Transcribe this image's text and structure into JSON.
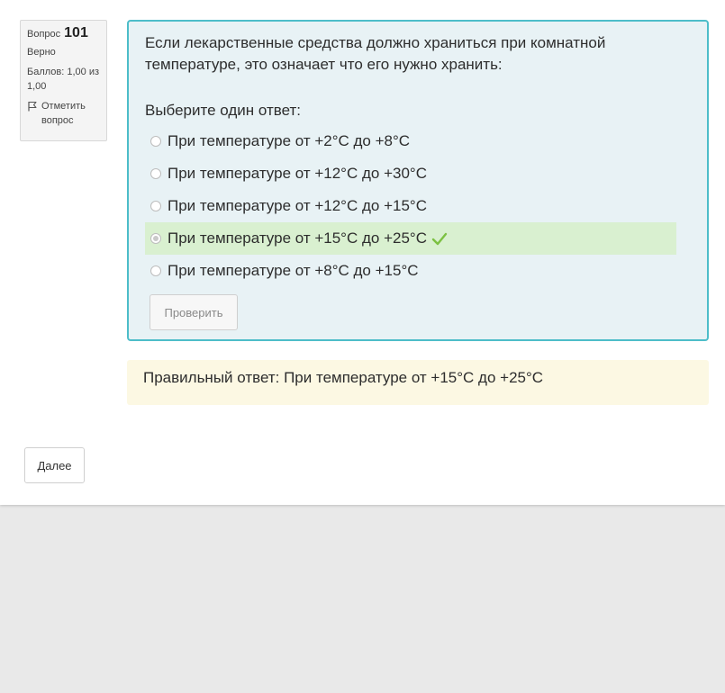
{
  "question_info": {
    "question_label": "Вопрос",
    "question_number": "101",
    "state": "Верно",
    "grade": "Баллов: 1,00 из 1,00",
    "flag_label": "Отметить вопрос"
  },
  "question": {
    "text": "Если лекарственные средства должно храниться при комнатной температуре, это означает что его нужно хранить:",
    "prompt": "Выберите один ответ:",
    "answers": [
      {
        "label": "При температуре от +2°C до +8°C",
        "selected": false,
        "correct": false
      },
      {
        "label": "При температуре от +12°C до +30°C",
        "selected": false,
        "correct": false
      },
      {
        "label": "При температуре от +12°C до +15°C",
        "selected": false,
        "correct": false
      },
      {
        "label": "При температуре от +15°C до +25°C",
        "selected": true,
        "correct": true
      },
      {
        "label": "При температуре от +8°C до +15°C",
        "selected": false,
        "correct": false
      }
    ],
    "check_button": "Проверить"
  },
  "feedback": {
    "right_answer": "Правильный ответ: При температуре от +15°C до +25°C"
  },
  "navigation": {
    "next_button": "Далее"
  },
  "colors": {
    "formulation_bg": "#e8f2f5",
    "formulation_border": "#4dbdc9",
    "correct_bg": "#d9f0d0",
    "correct_icon": "#7cc142",
    "feedback_bg": "#fcf8e3"
  }
}
